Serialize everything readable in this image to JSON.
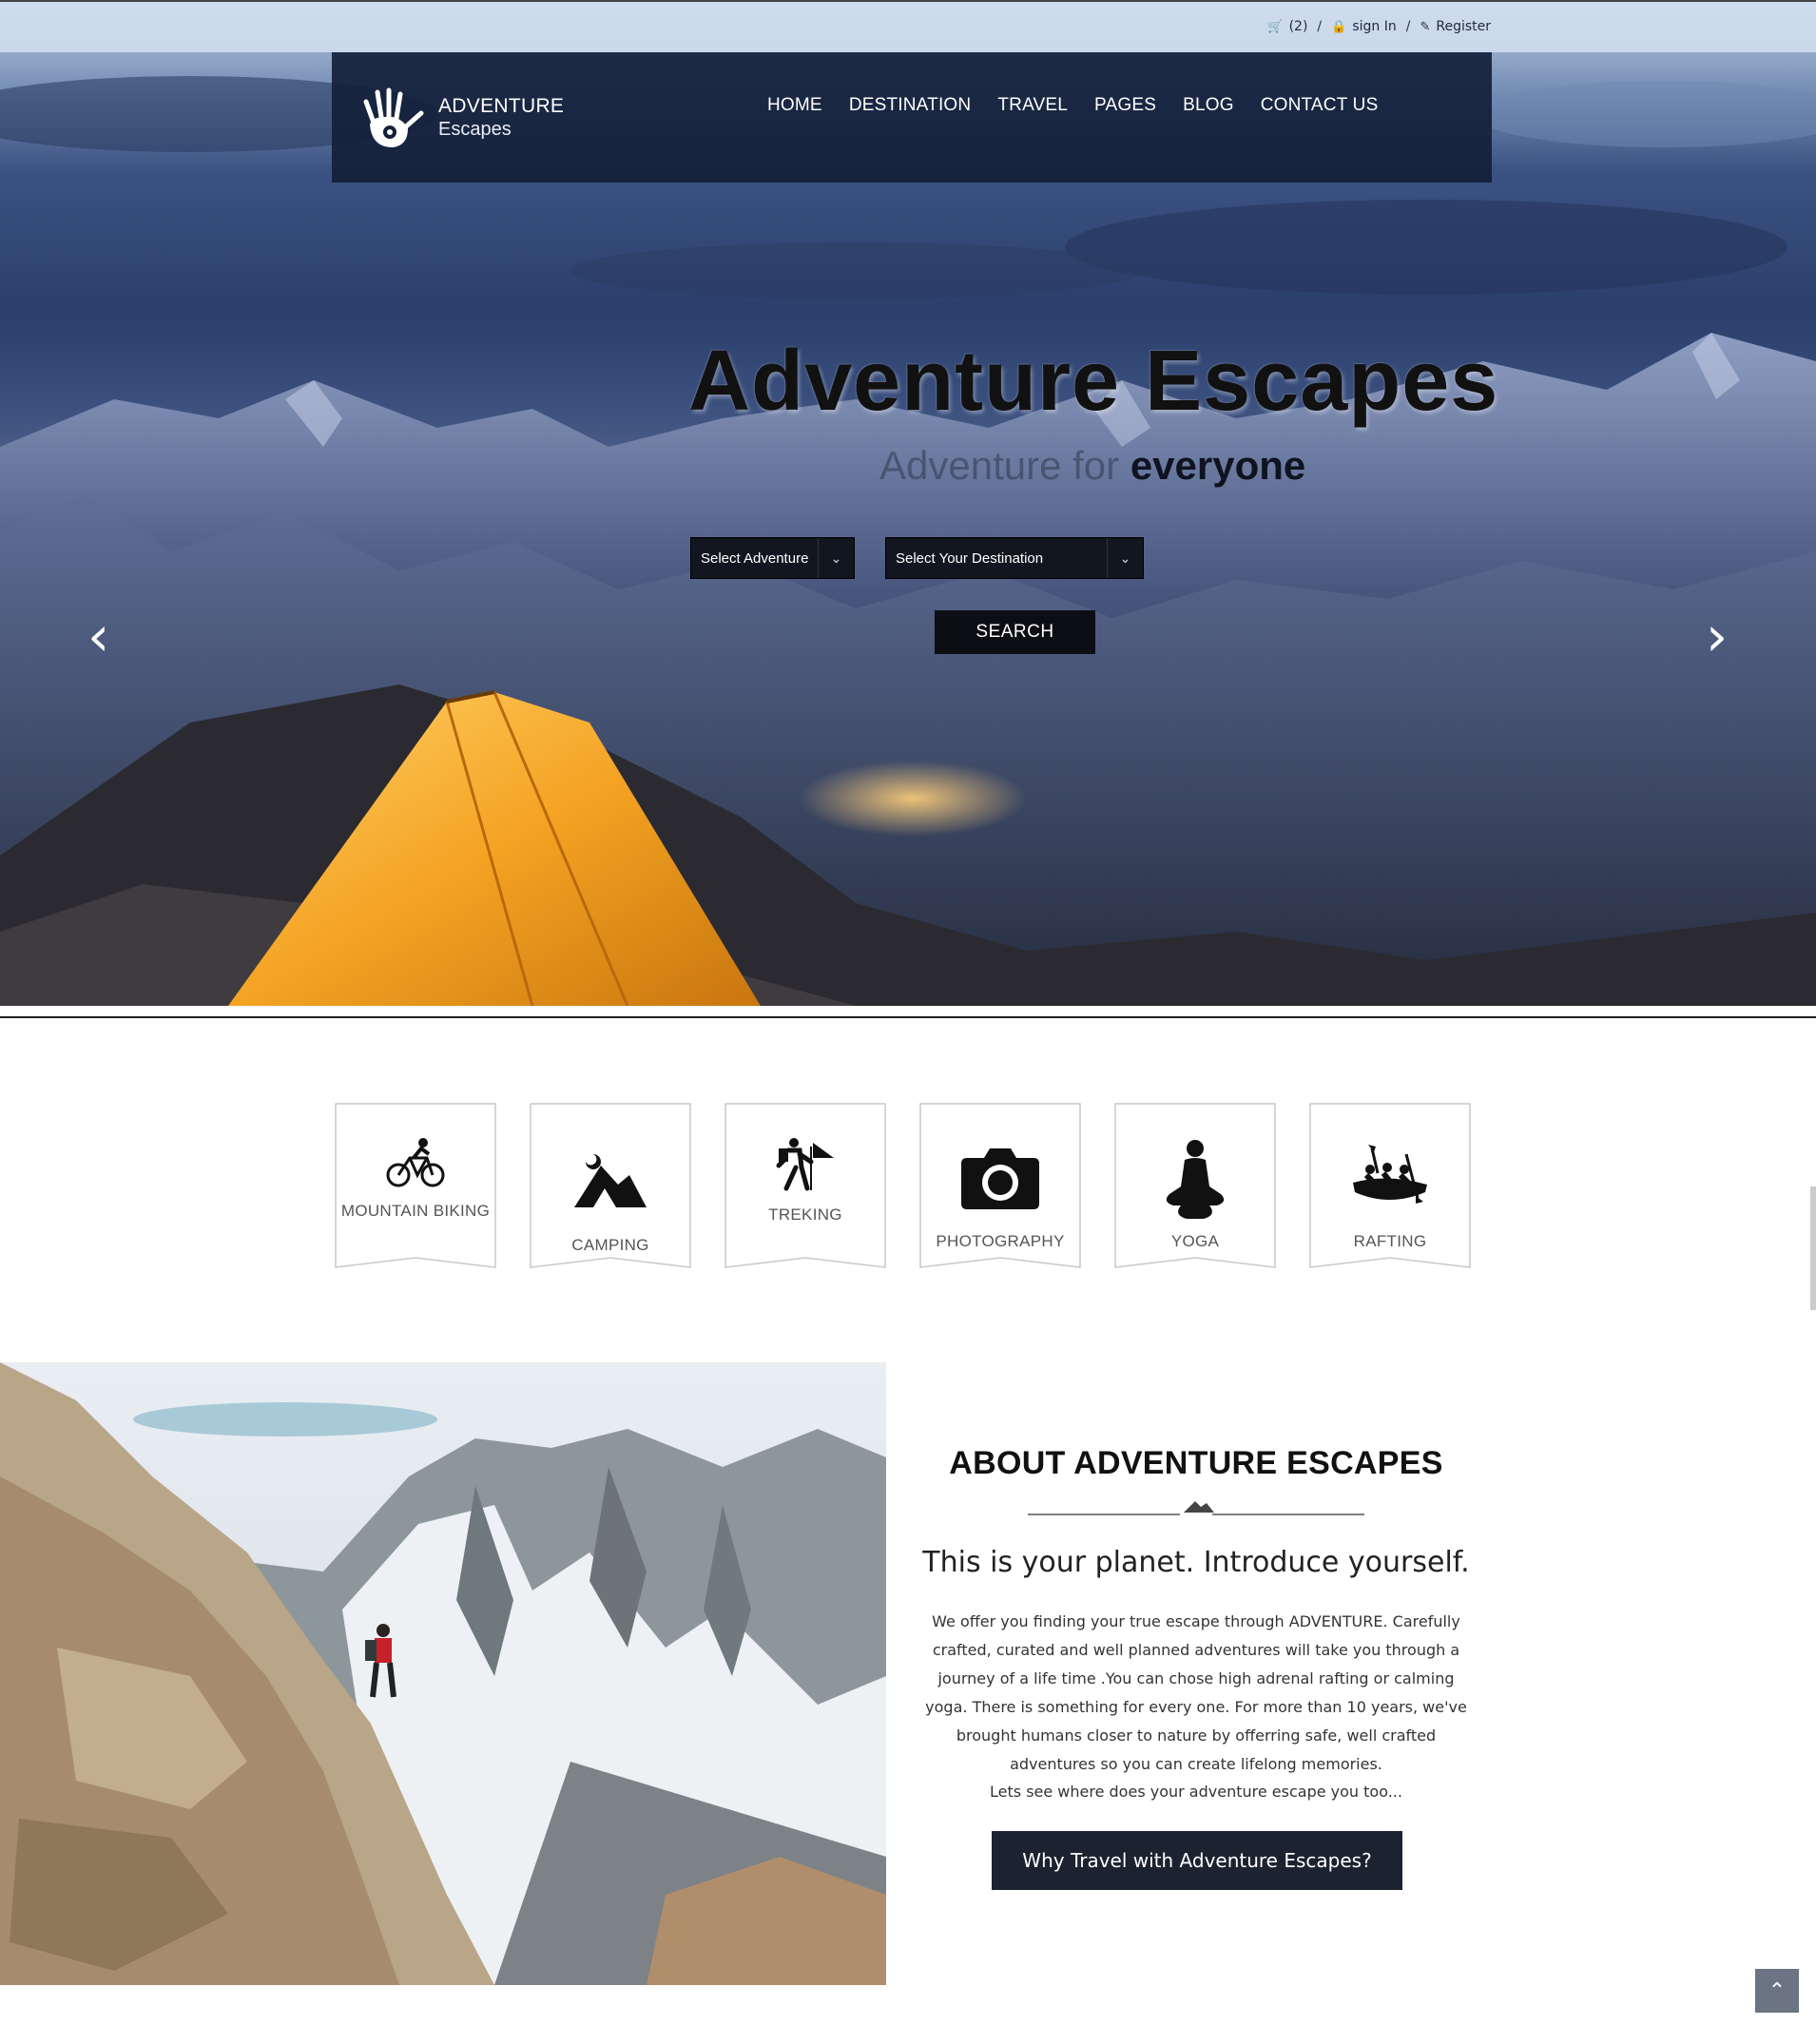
{
  "topbar": {
    "cart_label": "(2)",
    "signin_label": "sign In",
    "register_label": "Register",
    "separator": "/"
  },
  "logo": {
    "line1": "ADVENTURE",
    "line2": "Escapes"
  },
  "nav": [
    "HOME",
    "DESTINATION",
    "TRAVEL",
    "PAGES",
    "BLOG",
    "CONTACT US"
  ],
  "hero": {
    "title": "Adventure Escapes",
    "subtitle_light": "Adventure for",
    "subtitle_bold": "everyone",
    "select_adventure": "Select Adventure",
    "select_destination": "Select Your Destination",
    "search_label": "SEARCH"
  },
  "activities": [
    {
      "label": "MOUNTAIN BIKING",
      "icon": "mountain-biking-icon"
    },
    {
      "label": "CAMPING",
      "icon": "camping-icon"
    },
    {
      "label": "TREKING",
      "icon": "trekking-icon"
    },
    {
      "label": "PHOTOGRAPHY",
      "icon": "camera-icon"
    },
    {
      "label": "YOGA",
      "icon": "yoga-icon"
    },
    {
      "label": "RAFTING",
      "icon": "rafting-icon"
    }
  ],
  "about": {
    "heading": "ABOUT ADVENTURE ESCAPES",
    "tagline": "This is your planet. Introduce yourself.",
    "body": "We offer you finding your true escape through ADVENTURE. Carefully crafted, curated and well planned adventures will take you through a journey of a life time .You can chose high adrenal rafting or calming yoga. There is something for every one. For more than 10 years, we've brought humans closer to nature by offerring safe, well crafted adventures so you can create lifelong memories.",
    "body2": "Lets see where does your adventure escape you too...",
    "cta_label": "Why Travel with Adventure Escapes?"
  },
  "colors": {
    "nav_bg": "#14203a",
    "button_dark": "#1b2230",
    "tent": "#f4a323"
  }
}
